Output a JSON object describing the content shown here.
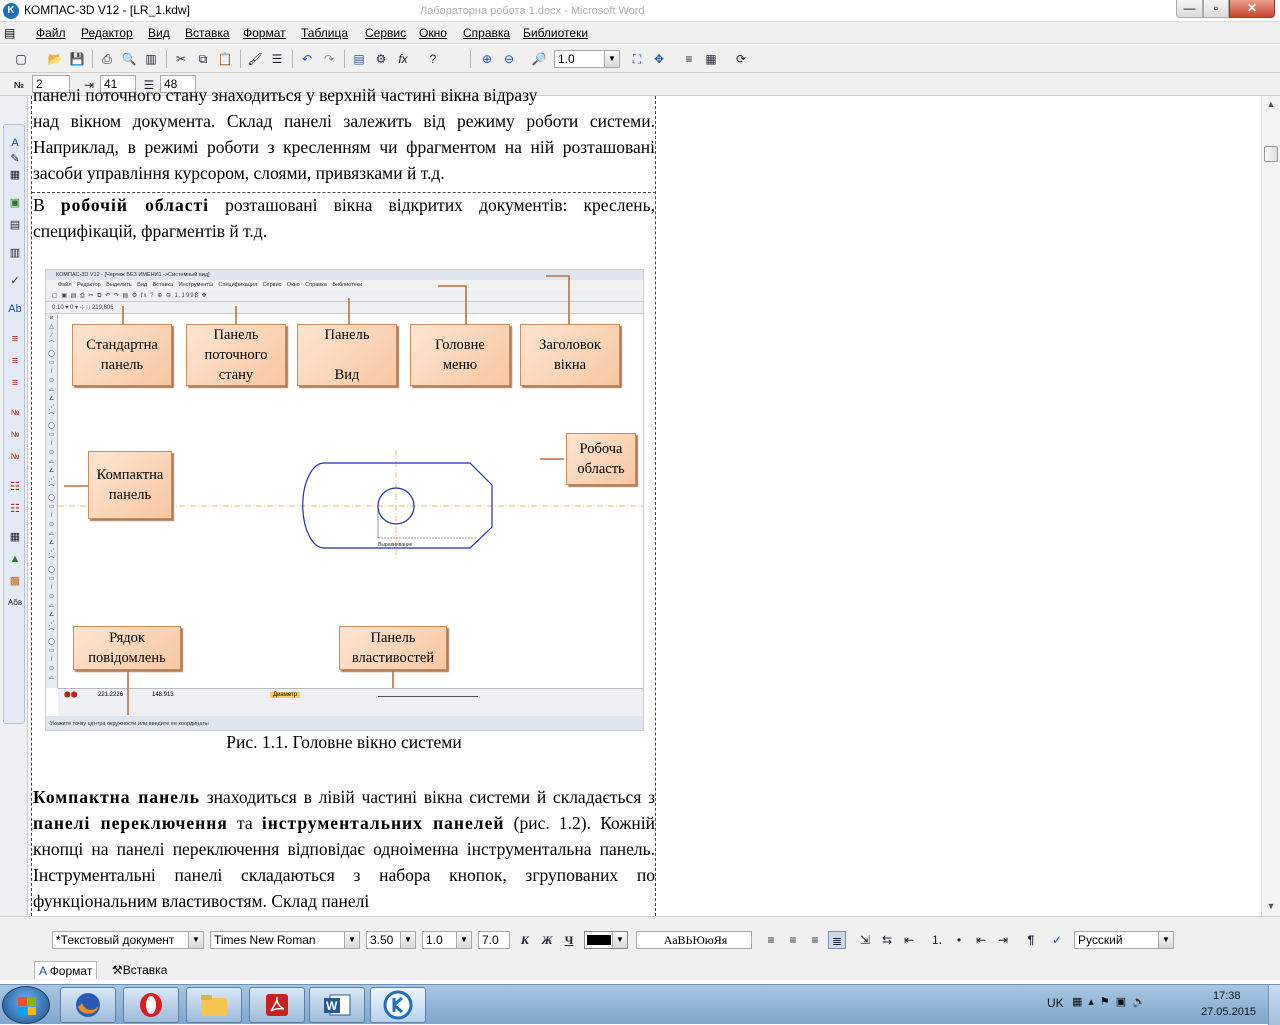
{
  "window": {
    "title": "КОМПАС-3D V12 - [LR_1.kdw]",
    "background_title": "Лабораторна робота 1.docx - Microsoft Word",
    "min_icon": "—",
    "max_icon": "▫",
    "close_icon": "✕"
  },
  "menu": [
    "Файл",
    "Редактор",
    "Вид",
    "Вставка",
    "Формат",
    "Таблица",
    "Сервис",
    "Окно",
    "Справка",
    "Библиотеки"
  ],
  "toolbar": {
    "zoom_value": "1.0"
  },
  "para_toolbar": {
    "num_label": "№",
    "num_value": "2",
    "indent_value": "41",
    "spacing_value": "48"
  },
  "document": {
    "p1_top": "панелі поточного стану знаходиться у верхній частині вікна відразу",
    "p1": "над вікном документа. Склад панелі залежить від режиму роботи системи. Наприклад, в режимі роботи з кресленням чи фрагментом на ній розташовані засоби управління курсором, слоями, привязками й т.д.",
    "p2_a": "В ",
    "p2_b": "робочій області",
    "p2_c": " розташовані вікна відкритих документів: креслень, специфікацій, фрагментів й т.д.",
    "caption": "Рис. 1.1. Головне вікно системи",
    "p3_a": "Компактна панель",
    "p3_b": " знаходиться в лівій частині вікна системи й складається з ",
    "p3_c": "панелі переключення",
    "p3_d": " та ",
    "p3_e": "інструментальних панелей",
    "p3_f": " (рис. 1.2). Кожній кнопці на панелі переключення відповідає одноіменна інструментальна панель. Інструментальні панелі складаються з набора кнопок, згрупованих по функціональним властивостям. Склад панелі"
  },
  "figure": {
    "title": "КОМПАС-3D V12 - [Чертеж БЕЗ ИМЕНИ1 ->Системный вид]",
    "menu": "Файл Редактор Выделить Вид Вставка Инструменты Спецификация Сервис Окно Справка Библиотеки",
    "zoom": "1.1998",
    "coords": "219.606",
    "status_x": "221.2226",
    "status_y": "148.913",
    "diameter": "Диаметр",
    "hint": "Укажите точку центра окружности или введите ее координаты",
    "dim_label": "Выравнивание",
    "callouts": {
      "standard": "Стандартна\nпанель",
      "current_state": "Панель\nпоточного\nстану",
      "view": "Панель\n\nВид",
      "main_menu": "Головне\nменю",
      "window_title": "Заголовок\nвікна",
      "compact": "Компактна\nпанель",
      "workspace": "Робоча\nобласть",
      "messages": "Рядок\nповідомлень",
      "properties": "Панель\nвластивостей"
    }
  },
  "format_toolbar": {
    "style": "*Текстовый документ",
    "font": "Times New Roman",
    "size": "3.50",
    "scale": "1.0",
    "step": "7.0",
    "bold": "К",
    "italic": "Ж",
    "underline": "Ч",
    "case_sample": "АаВЬЮюЯя",
    "paragraph": "¶",
    "language": "Русский"
  },
  "tabs": {
    "format": "Формат",
    "insert": "Вставка"
  },
  "tray": {
    "lang": "UK",
    "time": "17:38",
    "date": "27.05.2015"
  },
  "colors": {
    "callout_fill": "#f8c7a2",
    "callout_border": "#c98a5e",
    "drawing_blue": "#1f2fb0",
    "axis_orange": "#e8a040"
  }
}
